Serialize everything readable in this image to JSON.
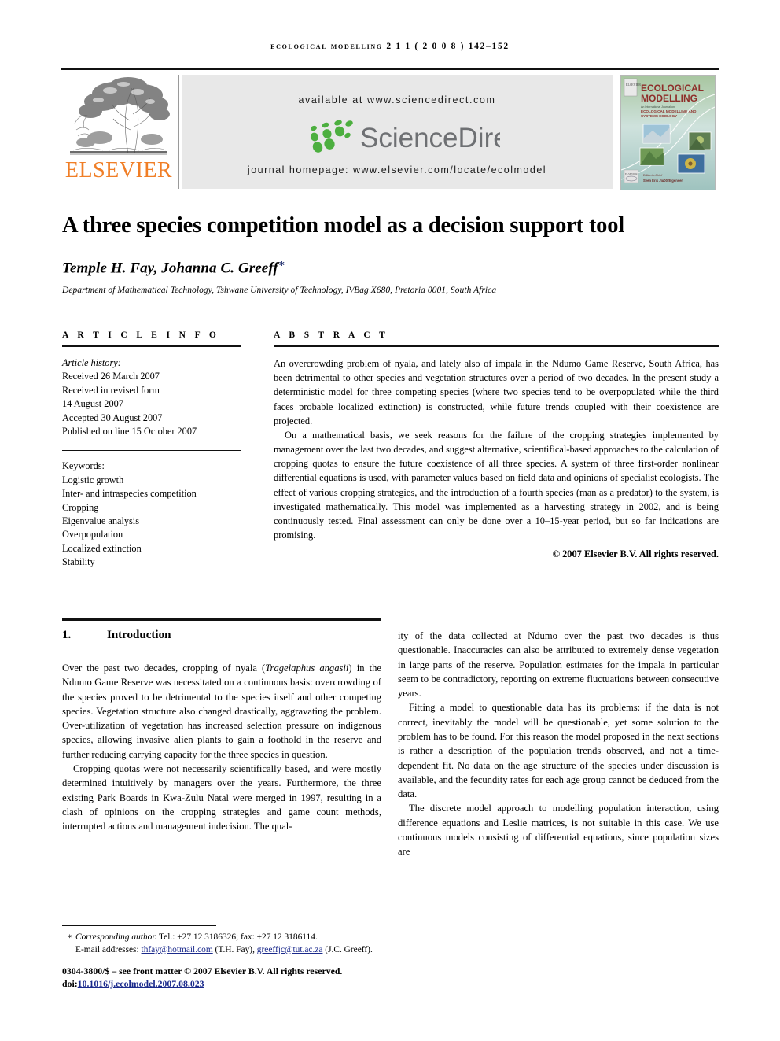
{
  "running_head": "ecological modelling 2 1 1 ( 2 0 0 8 ) 142–152",
  "banner": {
    "available_at": "available at www.sciencedirect.com",
    "journal_homepage": "journal homepage: www.elsevier.com/locate/ecolmodel",
    "sciencedirect_wordmark": "ScienceDirect",
    "elsevier_wordmark": "ELSEVIER",
    "logo_green": "#4caf3f",
    "logo_gray": "#6e7073",
    "elsevier_orange": "#f07e26",
    "banner_bg": "#e8e8e8"
  },
  "cover": {
    "title_line1": "ECOLOGICAL",
    "title_line2": "MODELLING",
    "subtitle_line1": "An International Journal on",
    "subtitle_line2": "ECOLOGICAL MODELLING AND",
    "subtitle_line3": "SYSTEMS ECOLOGY",
    "editor_line1": "Editor-in-Chief",
    "editor_line2": "Sven Erik Jørgensen",
    "cover_title_color": "#8e2f2a"
  },
  "article": {
    "title": "A three species competition model as a decision support tool",
    "authors": "Temple H. Fay, Johanna C. Greeff",
    "author_marker": "∗",
    "affiliation": "Department of Mathematical Technology, Tshwane University of Technology, P/Bag X680, Pretoria 0001, South Africa"
  },
  "article_info": {
    "heading": "A R T I C L E   I N F O",
    "history_label": "Article history:",
    "history": [
      "Received 26 March 2007",
      "Received in revised form",
      "14 August 2007",
      "Accepted 30 August 2007",
      "Published on line 15 October 2007"
    ],
    "keywords_label": "Keywords:",
    "keywords": [
      "Logistic growth",
      "Inter- and intraspecies competition",
      "Cropping",
      "Eigenvalue analysis",
      "Overpopulation",
      "Localized extinction",
      "Stability"
    ]
  },
  "abstract": {
    "heading": "A B S T R A C T",
    "paragraph1": "An overcrowding problem of nyala, and lately also of impala in the Ndumo Game Reserve, South Africa, has been detrimental to other species and vegetation structures over a period of two decades. In the present study a deterministic model for three competing species (where two species tend to be overpopulated while the third faces probable localized extinction) is constructed, while future trends coupled with their coexistence are projected.",
    "paragraph2": "On a mathematical basis, we seek reasons for the failure of the cropping strategies implemented by management over the last two decades, and suggest alternative, scientifical-based approaches to the calculation of cropping quotas to ensure the future coexistence of all three species. A system of three first-order nonlinear differential equations is used, with parameter values based on field data and opinions of specialist ecologists. The effect of various cropping strategies, and the introduction of a fourth species (man as a predator) to the system, is investigated mathematically. This model was implemented as a harvesting strategy in 2002, and is being continuously tested. Final assessment can only be done over a 10–15-year period, but so far indications are promising.",
    "copyright": "© 2007 Elsevier B.V. All rights reserved."
  },
  "section": {
    "number": "1.",
    "title": "Introduction"
  },
  "body": {
    "left": [
      "Over the past two decades, cropping of nyala (Tragelaphus angasii) in the Ndumo Game Reserve was necessitated on a continuous basis: overcrowding of the species proved to be detrimental to the species itself and other competing species. Vegetation structure also changed drastically, aggravating the problem. Over-utilization of vegetation has increased selection pressure on indigenous species, allowing invasive alien plants to gain a foothold in the reserve and further reducing carrying capacity for the three species in question.",
      "Cropping quotas were not necessarily scientifically based, and were mostly determined intuitively by managers over the years. Furthermore, the three existing Park Boards in Kwa-Zulu Natal were merged in 1997, resulting in a clash of opinions on the cropping strategies and game count methods, interrupted actions and management indecision. The qual-"
    ],
    "left_italic_species": "Tragelaphus angasii",
    "right": [
      "ity of the data collected at Ndumo over the past two decades is thus questionable. Inaccuracies can also be attributed to extremely dense vegetation in large parts of the reserve. Population estimates for the impala in particular seem to be contradictory, reporting on extreme fluctuations between consecutive years.",
      "Fitting a model to questionable data has its problems: if the data is not correct, inevitably the model will be questionable, yet some solution to the problem has to be found. For this reason the model proposed in the next sections is rather a description of the population trends observed, and not a time-dependent fit. No data on the age structure of the species under discussion is available, and the fecundity rates for each age group cannot be deduced from the data.",
      "The discrete model approach to modelling population interaction, using difference equations and Leslie matrices, is not suitable in this case. We use continuous models consisting of differential equations, since population sizes are"
    ]
  },
  "footnote": {
    "marker": "∗",
    "corresponding_label": "Corresponding author.",
    "contact": " Tel.: +27 12 3186326; fax: +27 12 3186114.",
    "email_label": "E-mail addresses:",
    "email1": "thfay@hotmail.com",
    "email1_attr": " (T.H. Fay), ",
    "email2": "greeffjc@tut.ac.za",
    "email2_attr": " (J.C. Greeff).",
    "issn_line": "0304-3800/$ – see front matter © 2007 Elsevier B.V. All rights reserved.",
    "doi_label": "doi:",
    "doi_value": "10.1016/j.ecolmodel.2007.08.023",
    "link_color": "#1b2a8c"
  }
}
